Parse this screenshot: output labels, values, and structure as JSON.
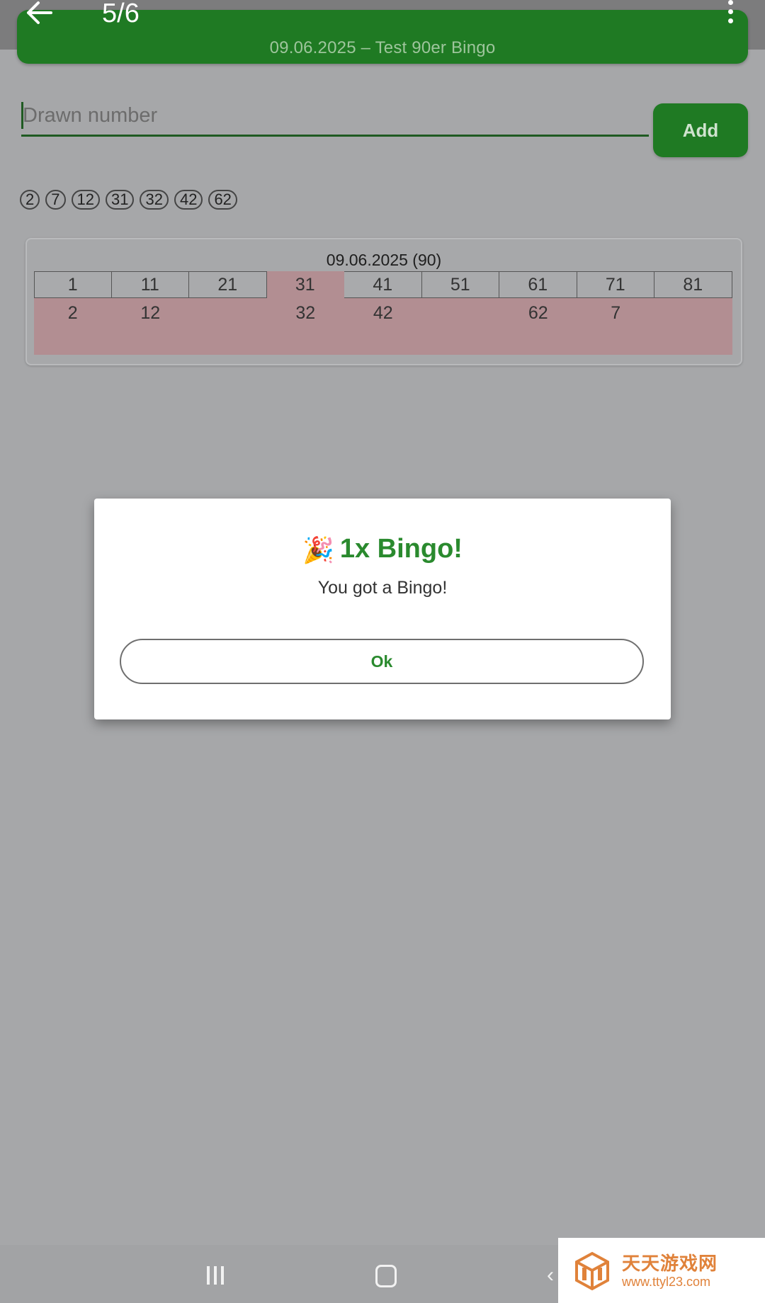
{
  "viewer": {
    "page_counter": "5/6"
  },
  "header": {
    "title": "09.06.2025 – Test 90er Bingo"
  },
  "drawn_input": {
    "placeholder": "Drawn number",
    "add_label": "Add"
  },
  "drawn_numbers": [
    "2",
    "7",
    "12",
    "31",
    "32",
    "42",
    "62"
  ],
  "card": {
    "title": "09.06.2025 (90)",
    "header_row": [
      "1",
      "11",
      "21",
      "31",
      "41",
      "51",
      "61",
      "71",
      "81"
    ],
    "marked_columns": [
      "31"
    ],
    "row2": [
      "2",
      "12",
      "",
      "32",
      "42",
      "",
      "62",
      "7",
      ""
    ]
  },
  "dialog": {
    "icon": "party-popper-icon",
    "title": "1x Bingo!",
    "message": "You got a Bingo!",
    "ok_label": "Ok"
  },
  "watermark": {
    "name": "天天游戏网",
    "url": "www.ttyl23.com"
  },
  "colors": {
    "primary": "#1f7a23",
    "dialog_accent": "#2a8a2e",
    "marked": "#b28e92"
  }
}
